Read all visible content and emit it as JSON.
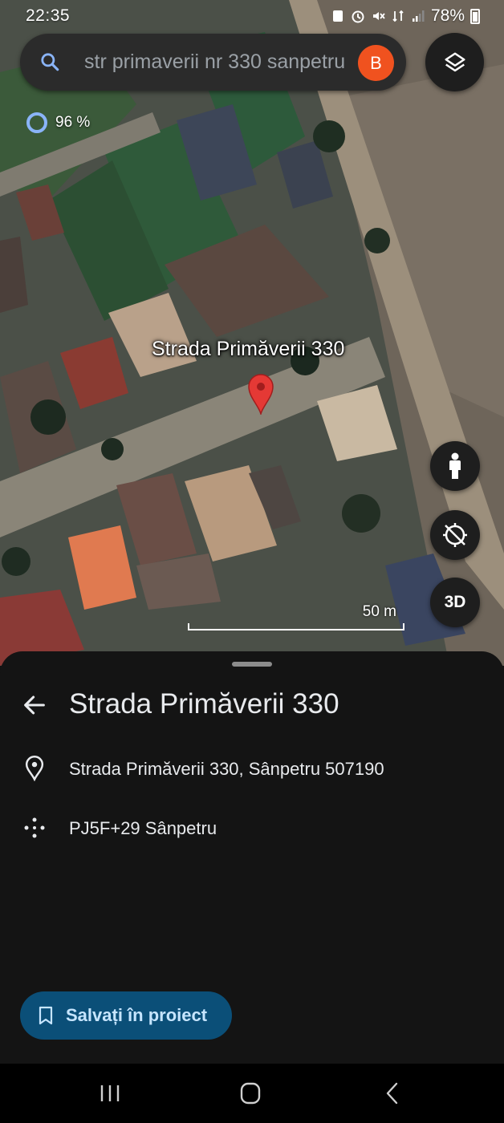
{
  "status_bar": {
    "time": "22:35",
    "battery": "78%"
  },
  "search": {
    "query": "str primaverii nr 330 sanpetru",
    "avatar_letter": "B"
  },
  "map": {
    "loading_percent": "96 %",
    "place_label": "Strada Primăverii 330",
    "scale_label": "50 m",
    "view_3d_label": "3D"
  },
  "sheet": {
    "title": "Strada Primăverii 330",
    "address": "Strada Primăverii 330, Sânpetru 507190",
    "plus_code": "PJ5F+29 Sânpetru",
    "save_button": "Salvați în proiect"
  },
  "colors": {
    "sheet_bg": "#141414",
    "save_button_bg": "#0b4f78",
    "save_button_text": "#c6e5ff",
    "pin": "#e53935",
    "avatar": "#f0521f",
    "loading_ring": "#8ab4f8"
  },
  "icons": {
    "search": "search-icon",
    "layers": "layers-icon",
    "pegman": "pegman-icon",
    "compass": "compass-off-icon",
    "pin": "map-pin-icon",
    "back": "arrow-back-icon",
    "location": "location-pin-icon",
    "plus_code": "plus-code-icon",
    "bookmark": "bookmark-icon"
  }
}
